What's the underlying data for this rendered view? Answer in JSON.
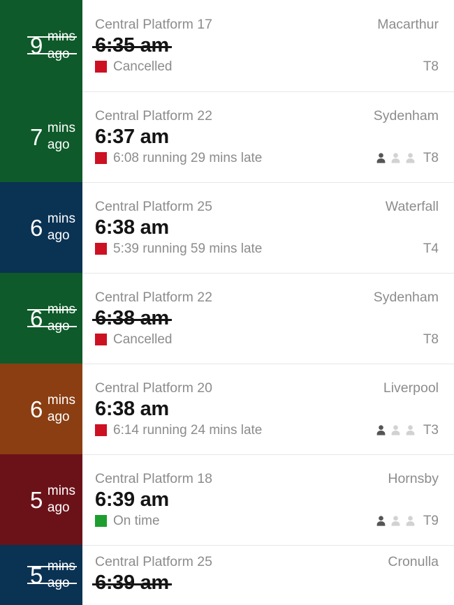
{
  "board": {
    "station": "Central",
    "labels": {
      "unit_line1": "mins",
      "unit_line2": "ago"
    },
    "status_colors": {
      "cancelled": "#cc1122",
      "late": "#cc1122",
      "on_time": "#1d9e2e"
    },
    "occupancy_colors": {
      "filled": "#555555",
      "empty": "#d2d2d2"
    },
    "text_colors": {
      "muted": "#8c8c8c",
      "primary": "#141414"
    }
  },
  "departures": [
    {
      "minutes": "9",
      "unit_line1": "mins",
      "unit_line2": "ago",
      "platform": "Central Platform 17",
      "destination": "Macarthur",
      "time": "6:35 am",
      "status_text": "Cancelled",
      "status_color": "#cc1122",
      "line_code": "T8",
      "line_color": "#0e5a2a",
      "cancelled": true,
      "occupancy": [
        1,
        0,
        0
      ],
      "show_occupancy": false
    },
    {
      "minutes": "7",
      "unit_line1": "mins",
      "unit_line2": "ago",
      "platform": "Central Platform 22",
      "destination": "Sydenham",
      "time": "6:37 am",
      "status_text": "6:08 running 29 mins late",
      "status_color": "#cc1122",
      "line_code": "T8",
      "line_color": "#0e5a2a",
      "cancelled": false,
      "occupancy": [
        1,
        0,
        0
      ],
      "show_occupancy": true
    },
    {
      "minutes": "6",
      "unit_line1": "mins",
      "unit_line2": "ago",
      "platform": "Central Platform 25",
      "destination": "Waterfall",
      "time": "6:38 am",
      "status_text": "5:39 running 59 mins late",
      "status_color": "#cc1122",
      "line_code": "T4",
      "line_color": "#0a3253",
      "cancelled": false,
      "occupancy": [
        0,
        0,
        0
      ],
      "show_occupancy": false
    },
    {
      "minutes": "6",
      "unit_line1": "mins",
      "unit_line2": "ago",
      "platform": "Central Platform 22",
      "destination": "Sydenham",
      "time": "6:38 am",
      "status_text": "Cancelled",
      "status_color": "#cc1122",
      "line_code": "T8",
      "line_color": "#0e5a2a",
      "cancelled": true,
      "occupancy": [
        0,
        0,
        0
      ],
      "show_occupancy": false
    },
    {
      "minutes": "6",
      "unit_line1": "mins",
      "unit_line2": "ago",
      "platform": "Central Platform 20",
      "destination": "Liverpool",
      "time": "6:38 am",
      "status_text": "6:14 running 24 mins late",
      "status_color": "#cc1122",
      "line_code": "T3",
      "line_color": "#8a3e12",
      "cancelled": false,
      "occupancy": [
        1,
        0,
        0
      ],
      "show_occupancy": true
    },
    {
      "minutes": "5",
      "unit_line1": "mins",
      "unit_line2": "ago",
      "platform": "Central Platform 18",
      "destination": "Hornsby",
      "time": "6:39 am",
      "status_text": "On time",
      "status_color": "#1d9e2e",
      "line_code": "T9",
      "line_color": "#6b1219",
      "cancelled": false,
      "occupancy": [
        1,
        0,
        0
      ],
      "show_occupancy": true
    },
    {
      "minutes": "5",
      "unit_line1": "mins",
      "unit_line2": "ago",
      "platform": "Central Platform 25",
      "destination": "Cronulla",
      "time": "6:39 am",
      "status_text": "",
      "status_color": "#cc1122",
      "line_code": "",
      "line_color": "#0a3253",
      "cancelled": true,
      "occupancy": [
        0,
        0,
        0
      ],
      "show_occupancy": false
    }
  ]
}
